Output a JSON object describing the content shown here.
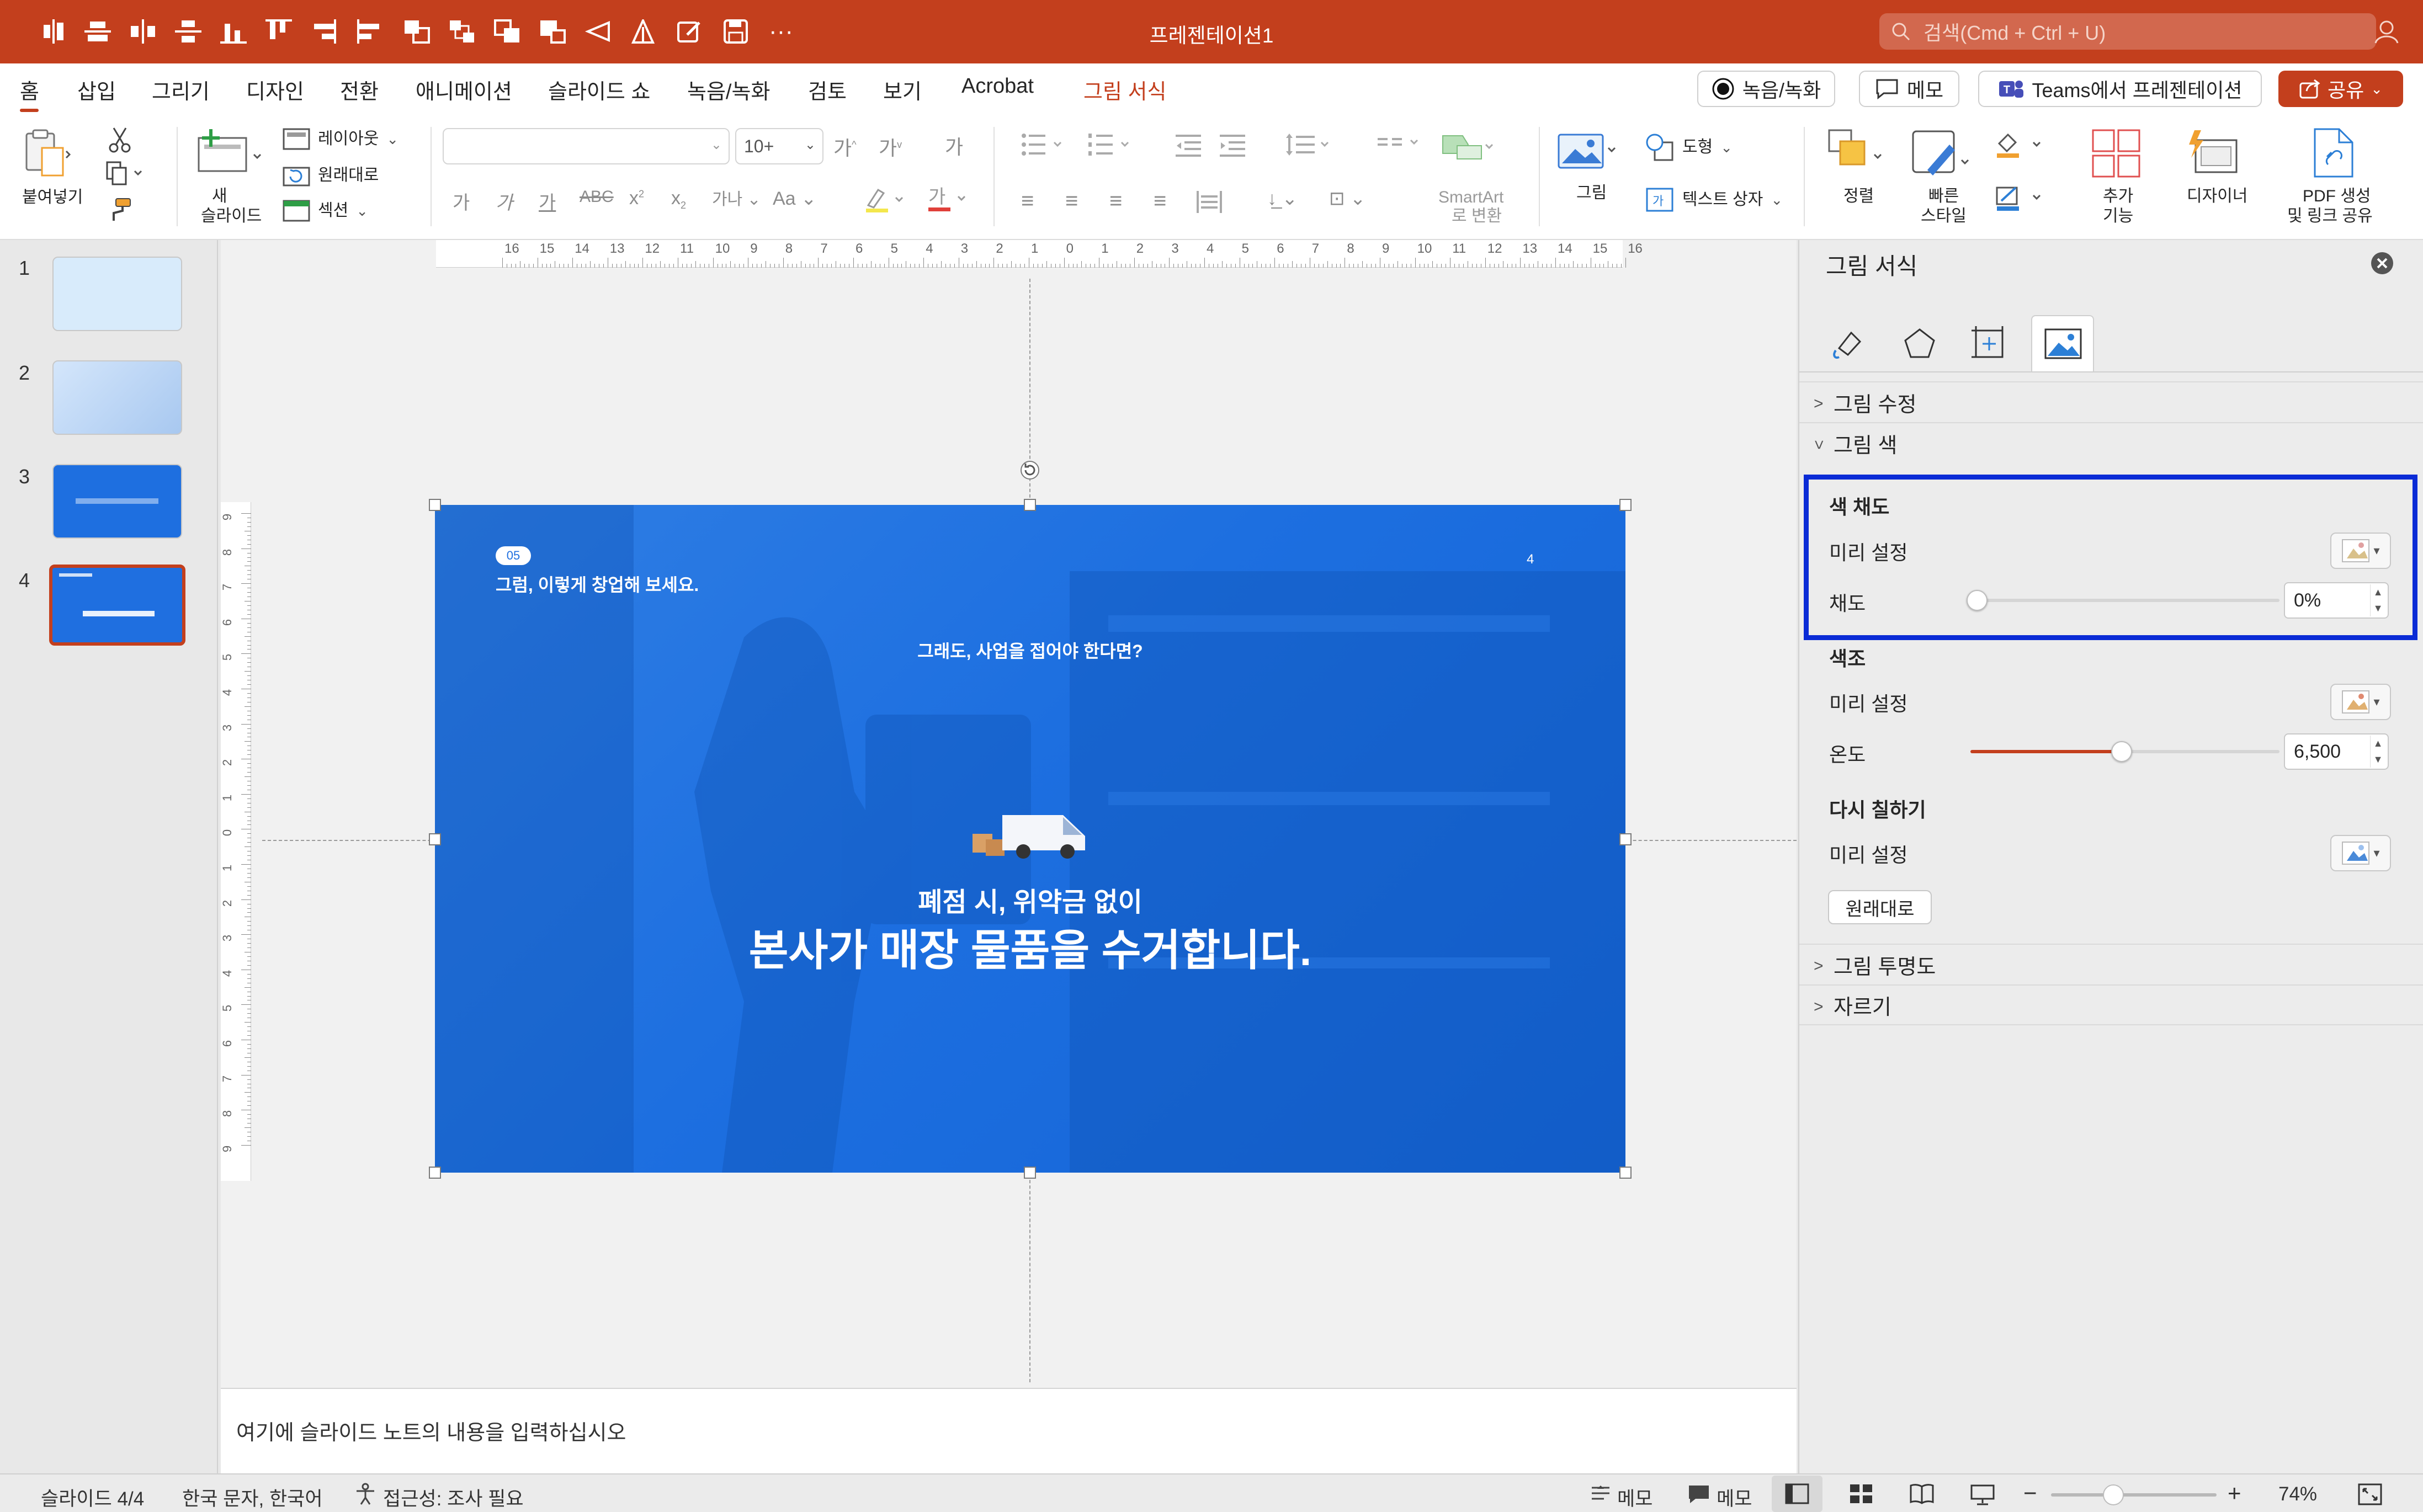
{
  "titlebar": {
    "doc_title": "프레젠테이션1",
    "search_placeholder": "검색(Cmd + Ctrl + U)"
  },
  "tabs": [
    "홈",
    "삽입",
    "그리기",
    "디자인",
    "전환",
    "애니메이션",
    "슬라이드 쇼",
    "녹음/녹화",
    "검토",
    "보기",
    "Acrobat",
    "그림 서식"
  ],
  "active_tab": "홈",
  "right_buttons": {
    "record": "녹음/녹화",
    "memo": "메모",
    "teams": "Teams에서 프레젠테이션",
    "share": "공유"
  },
  "ribbon": {
    "paste": "붙여넣기",
    "new_slide": "새\n슬라이드",
    "new_slide_l1": "새",
    "new_slide_l2": "슬라이드",
    "layout": "레이아웃",
    "reset": "원래대로",
    "section": "섹션",
    "font_size": "10+",
    "picture": "그림",
    "shapes": "도형",
    "textbox": "텍스트 상자",
    "smartart_l1": "SmartArt",
    "smartart_l2": "로 변환",
    "arrange": "정렬",
    "quick_styles_l1": "빠른",
    "quick_styles_l2": "스타일",
    "addins_l1": "추가",
    "addins_l2": "기능",
    "designer": "디자이너",
    "pdf_l1": "PDF 생성",
    "pdf_l2": "및 링크 공유"
  },
  "thumbnails": [
    {
      "num": "1"
    },
    {
      "num": "2"
    },
    {
      "num": "3"
    },
    {
      "num": "4"
    }
  ],
  "ruler": {
    "h_ticks": [
      "16",
      "15",
      "14",
      "13",
      "12",
      "11",
      "10",
      "9",
      "8",
      "7",
      "6",
      "5",
      "4",
      "3",
      "2",
      "1",
      "0",
      "1",
      "2",
      "3",
      "4",
      "5",
      "6",
      "7",
      "8",
      "9",
      "10",
      "11",
      "12",
      "13",
      "14",
      "15",
      "16"
    ],
    "v_ticks": [
      "9",
      "8",
      "7",
      "6",
      "5",
      "4",
      "3",
      "2",
      "1",
      "0",
      "1",
      "2",
      "3",
      "4",
      "5",
      "6",
      "7",
      "8",
      "9"
    ]
  },
  "slide": {
    "badge": "05",
    "subtitle": "그럼, 이렇게 창업해 보세요.",
    "page_num": "4",
    "question": "그래도, 사업을 접어야 한다면?",
    "line1": "폐점 시, 위약금 없이",
    "line2": "본사가 매장 물품을 수거합니다."
  },
  "notes_placeholder": "여기에 슬라이드 노트의 내용을 입력하십시오",
  "format_pane": {
    "title": "그림 서식",
    "sections": {
      "correction": "그림 수정",
      "color": "그림 색",
      "transparency": "그림 투명도",
      "crop": "자르기"
    },
    "saturation_header": "색 채도",
    "preset": "미리 설정",
    "saturation_label": "채도",
    "saturation_value": "0%",
    "saturation_level": 0.0,
    "tone_header": "색조",
    "temperature_label": "온도",
    "temperature_value": "6,500",
    "temperature_level": 0.49,
    "recolor_header": "다시 칠하기",
    "reset_button": "원래대로",
    "highlight_color": "#0a2bd6"
  },
  "status": {
    "slide_count": "슬라이드 4/4",
    "language": "한국 문자, 한국어",
    "accessibility": "접근성: 조사 필요",
    "notes": "메모",
    "comments": "메모",
    "zoom": "74%"
  },
  "colors": {
    "accent": "#c33f1d",
    "slide_blue": "#1f6fe0"
  }
}
